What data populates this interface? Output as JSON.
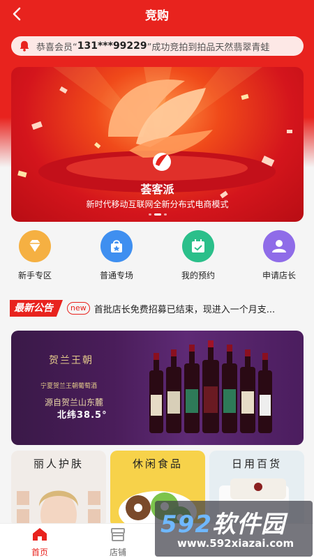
{
  "header": {
    "title": "竞购"
  },
  "notice": {
    "prefix": "恭喜会员“",
    "phone": "131***99229",
    "suffix": "”成功竞拍到拍品天然翡翠青蛙"
  },
  "banner": {
    "brand": "荟客派",
    "caption": "新时代移动互联网全新分布式电商模式"
  },
  "quick_menu": [
    {
      "label": "新手专区",
      "icon": "diamond-icon",
      "color": "#f5b042"
    },
    {
      "label": "普通专场",
      "icon": "shopping-bag-icon",
      "color": "#3f8ff0"
    },
    {
      "label": "我的预约",
      "icon": "calendar-icon",
      "color": "#2bbf8a"
    },
    {
      "label": "申请店长",
      "icon": "user-icon",
      "color": "#8f6ce8"
    }
  ],
  "announcement": {
    "tag": "最新公告",
    "badge": "new",
    "text": "首批店长免费招募已结束，现进入一个月支..."
  },
  "wine_banner": {
    "logo": "贺兰王朝",
    "line1": "宁夏贺兰王朝葡萄酒",
    "line2": "源自贺兰山东麓",
    "line3": "北纬38.5°"
  },
  "categories": [
    {
      "title": "丽人护肤",
      "bg": "#f1ece8"
    },
    {
      "title": "休闲食品",
      "bg": "#f7d24a"
    },
    {
      "title": "日用百货",
      "bg": "#e6eef2"
    }
  ],
  "tabbar": [
    {
      "label": "首页",
      "icon": "home-icon",
      "active": true
    },
    {
      "label": "店铺",
      "icon": "store-icon",
      "active": false
    }
  ],
  "watermark": {
    "big_num": "592",
    "big_text": "软件园",
    "url": "www.592xiazai.com"
  },
  "colors": {
    "primary": "#e8231e",
    "text": "#222222"
  }
}
